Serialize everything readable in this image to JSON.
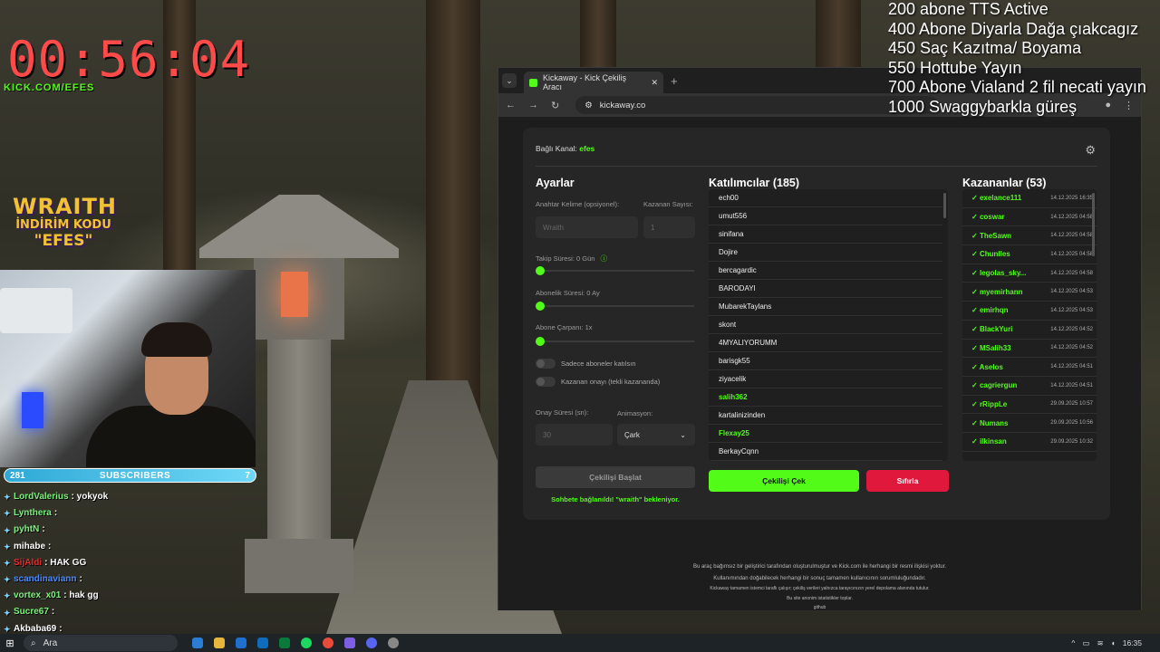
{
  "stream": {
    "timer": "00:56:04",
    "kick_link": "KICK.COM/EFES",
    "sponsor": {
      "line1": "WRAITH",
      "line2": "İNDİRİM KODU",
      "line3": "\"EFES\""
    },
    "subscribers": {
      "left": "281",
      "label": "SUBSCRIBERS",
      "right": "7"
    },
    "goals": [
      "200 abone TTS Active",
      "400 Abone Diyarla Dağa çıakcagız",
      "450 Saç Kazıtma/ Boyama",
      "550 Hottube Yayın",
      "700 Abone Vialand 2 fil necati yayın",
      "1000 Swaggybarkla güreş"
    ],
    "chat": [
      {
        "user": "LordValerius",
        "text": ": yokyok",
        "color": "#7ef07e"
      },
      {
        "user": "Lynthera",
        "text": ":",
        "color": "#7ef07e"
      },
      {
        "user": "pyhtN",
        "text": ":",
        "color": "#7ef07e"
      },
      {
        "user": "mihabe",
        "text": ":",
        "color": "#ffffff"
      },
      {
        "user": "SijAldi",
        "text": ": HAK GG",
        "color": "#e03030"
      },
      {
        "user": "scandinaviann",
        "text": ":",
        "color": "#4a8cff"
      },
      {
        "user": "vortex_x01",
        "text": ": hak gg",
        "color": "#7ef07e"
      },
      {
        "user": "Sucre67",
        "text": ":",
        "color": "#7ef07e"
      },
      {
        "user": "Akbaba69",
        "text": ":",
        "color": "#ffffff"
      }
    ]
  },
  "browser": {
    "tab_title": "Kickaway - Kick Çekiliş Aracı",
    "url": "kickaway.co"
  },
  "app": {
    "channel_label": "Bağlı Kanal:",
    "channel_name": "efes",
    "settings_title": "Ayarlar",
    "keyword_label": "Anahtar Kelime (opsiyonel):",
    "keyword_value": "Wraith",
    "winner_count_label": "Kazanan Sayısı:",
    "winner_count_value": "1",
    "follow_label": "Takip Süresi: 0 Gün",
    "sub_label": "Abonelik Süresi: 0 Ay",
    "multiplier_label": "Abone Çarpanı: 1x",
    "toggle_subs_only": "Sadece aboneler katılsın",
    "toggle_winner_confirm": "Kazanan onayı (tekli kazananda)",
    "confirm_time_label": "Onay Süresi (sn):",
    "confirm_time_value": "30",
    "animation_label": "Animasyon:",
    "animation_value": "Çark",
    "start_button": "Çekilişi Başlat",
    "status_text": "Sohbete bağlanıldı! \"wraith\" bekleniyor.",
    "participants_title": "Katılımcılar (185)",
    "participants": [
      {
        "name": "ech00",
        "hl": false
      },
      {
        "name": "umut556",
        "hl": false
      },
      {
        "name": "sinifana",
        "hl": false
      },
      {
        "name": "Dojire",
        "hl": false
      },
      {
        "name": "bercagardic",
        "hl": false
      },
      {
        "name": "BARODAYI",
        "hl": false
      },
      {
        "name": "MubarekTaylans",
        "hl": false
      },
      {
        "name": "skont",
        "hl": false
      },
      {
        "name": "4MYALIYORUMM",
        "hl": false
      },
      {
        "name": "barisgk55",
        "hl": false
      },
      {
        "name": "ziyacelik",
        "hl": false
      },
      {
        "name": "salih362",
        "hl": true
      },
      {
        "name": "kartalinizinden",
        "hl": false
      },
      {
        "name": "Flexay25",
        "hl": true
      },
      {
        "name": "BerkayCqnn",
        "hl": false
      }
    ],
    "draw_button": "Çekilişi Çek",
    "reset_button": "Sıfırla",
    "winners_title": "Kazananlar (53)",
    "winners": [
      {
        "name": "exelance111",
        "date": "14.12.2025 16:35"
      },
      {
        "name": "coswar",
        "date": "14.12.2025 04:58"
      },
      {
        "name": "TheSawn",
        "date": "14.12.2025 04:58"
      },
      {
        "name": "Chunlles",
        "date": "14.12.2025 04:58"
      },
      {
        "name": "legolas_sky...",
        "date": "14.12.2025 04:58"
      },
      {
        "name": "myemirhann",
        "date": "14.12.2025 04:53"
      },
      {
        "name": "emirhqn",
        "date": "14.12.2025 04:53"
      },
      {
        "name": "BlackYuri",
        "date": "14.12.2025 04:52"
      },
      {
        "name": "MSalih33",
        "date": "14.12.2025 04:52"
      },
      {
        "name": "Aselos",
        "date": "14.12.2025 04:51"
      },
      {
        "name": "cagriergun",
        "date": "14.12.2025 04:51"
      },
      {
        "name": "rRippLe",
        "date": "29.09.2025 10:57"
      },
      {
        "name": "Numans",
        "date": "29.09.2025 10:56"
      },
      {
        "name": "ilkinsan",
        "date": "29.09.2025 10:32"
      }
    ],
    "footer": [
      "Bu araç bağımsız bir geliştirici tarafından oluşturulmuştur ve Kick.com ile herhangi bir resmi ilişkisi yoktur.",
      "Kullanımından doğabilecek herhangi bir sonuç tamamen kullanıcının sorumluluğundadır.",
      "Kickaway tamamen istemci taraflı çalışır; çekiliş verileri yalnızca tarayıcınızın yerel depolama alanında tutulur.",
      "Bu site anonim istatistikler toplar.",
      "github"
    ]
  },
  "taskbar": {
    "search": "Ara",
    "time": "16:35"
  }
}
